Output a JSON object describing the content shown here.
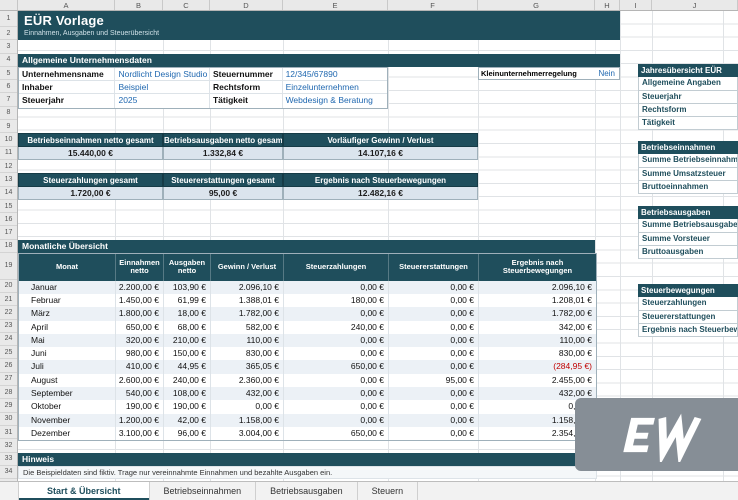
{
  "colors": {
    "accent": "#1F4E5C",
    "input_blue": "#2068B0",
    "negative": "#C00000",
    "summary_fill": "#DBE4ED"
  },
  "grid": {
    "cols": [
      "A",
      "B",
      "C",
      "D",
      "E",
      "F",
      "G",
      "H",
      "I",
      "J"
    ],
    "rows": [
      "1",
      "2",
      "3",
      "4",
      "5",
      "6",
      "7",
      "8",
      "9",
      "10",
      "11",
      "12",
      "13",
      "14",
      "15",
      "16",
      "17",
      "18",
      "19",
      "20",
      "21",
      "22",
      "23",
      "24",
      "25",
      "26",
      "27",
      "28",
      "29",
      "30",
      "31",
      "32",
      "33",
      "34"
    ]
  },
  "banner": {
    "title": "EÜR Vorlage",
    "subtitle": "Einnahmen, Ausgaben und Steuerübersicht"
  },
  "company": {
    "section_title": "Allgemeine Unternehmensdaten",
    "rows": [
      {
        "label1": "Unternehmensname",
        "value1": "Nordlicht Design Studio",
        "label2": "Steuernummer",
        "value2": "12/345/67890"
      },
      {
        "label1": "Inhaber",
        "value1": "Beispiel",
        "label2": "Rechtsform",
        "value2": "Einzelunternehmen"
      },
      {
        "label1": "Steuerjahr",
        "value1": "2025",
        "label2": "Tätigkeit",
        "value2": "Webdesign & Beratung"
      }
    ],
    "klein": {
      "label": "Kleinunternehmerregelung",
      "value": "Nein"
    }
  },
  "summary1": {
    "headers": [
      "Betriebseinnahmen netto gesamt",
      "Betriebsausgaben netto gesamt",
      "Vorläufiger Gewinn / Verlust"
    ],
    "values": [
      "15.440,00 €",
      "1.332,84 €",
      "14.107,16 €"
    ]
  },
  "summary2": {
    "headers": [
      "Steuerzahlungen gesamt",
      "Steuererstattungen gesamt",
      "Ergebnis nach Steuerbewegungen"
    ],
    "values": [
      "1.720,00 €",
      "95,00 €",
      "12.482,16 €"
    ]
  },
  "monthly": {
    "section_title": "Monatliche Übersicht",
    "headers": [
      "Monat",
      "Einnahmen netto",
      "Ausgaben netto",
      "Gewinn / Verlust",
      "Steuerzahlungen",
      "Steuererstattungen",
      "Ergebnis nach Steuerbewegungen"
    ],
    "rows": [
      {
        "monat": "Januar",
        "einnahmen": "2.200,00 €",
        "ausgaben": "103,90 €",
        "gewinn": "2.096,10 €",
        "zahlungen": "0,00 €",
        "erstattungen": "0,00 €",
        "ergebnis": "2.096,10 €"
      },
      {
        "monat": "Februar",
        "einnahmen": "1.450,00 €",
        "ausgaben": "61,99 €",
        "gewinn": "1.388,01 €",
        "zahlungen": "180,00 €",
        "erstattungen": "0,00 €",
        "ergebnis": "1.208,01 €"
      },
      {
        "monat": "März",
        "einnahmen": "1.800,00 €",
        "ausgaben": "18,00 €",
        "gewinn": "1.782,00 €",
        "zahlungen": "0,00 €",
        "erstattungen": "0,00 €",
        "ergebnis": "1.782,00 €"
      },
      {
        "monat": "April",
        "einnahmen": "650,00 €",
        "ausgaben": "68,00 €",
        "gewinn": "582,00 €",
        "zahlungen": "240,00 €",
        "erstattungen": "0,00 €",
        "ergebnis": "342,00 €"
      },
      {
        "monat": "Mai",
        "einnahmen": "320,00 €",
        "ausgaben": "210,00 €",
        "gewinn": "110,00 €",
        "zahlungen": "0,00 €",
        "erstattungen": "0,00 €",
        "ergebnis": "110,00 €"
      },
      {
        "monat": "Juni",
        "einnahmen": "980,00 €",
        "ausgaben": "150,00 €",
        "gewinn": "830,00 €",
        "zahlungen": "0,00 €",
        "erstattungen": "0,00 €",
        "ergebnis": "830,00 €"
      },
      {
        "monat": "Juli",
        "einnahmen": "410,00 €",
        "ausgaben": "44,95 €",
        "gewinn": "365,05 €",
        "zahlungen": "650,00 €",
        "erstattungen": "0,00 €",
        "ergebnis": "(284,95 €)"
      },
      {
        "monat": "August",
        "einnahmen": "2.600,00 €",
        "ausgaben": "240,00 €",
        "gewinn": "2.360,00 €",
        "zahlungen": "0,00 €",
        "erstattungen": "95,00 €",
        "ergebnis": "2.455,00 €"
      },
      {
        "monat": "September",
        "einnahmen": "540,00 €",
        "ausgaben": "108,00 €",
        "gewinn": "432,00 €",
        "zahlungen": "0,00 €",
        "erstattungen": "0,00 €",
        "ergebnis": "432,00 €"
      },
      {
        "monat": "Oktober",
        "einnahmen": "190,00 €",
        "ausgaben": "190,00 €",
        "gewinn": "0,00 €",
        "zahlungen": "0,00 €",
        "erstattungen": "0,00 €",
        "ergebnis": "0,00 €"
      },
      {
        "monat": "November",
        "einnahmen": "1.200,00 €",
        "ausgaben": "42,00 €",
        "gewinn": "1.158,00 €",
        "zahlungen": "0,00 €",
        "erstattungen": "0,00 €",
        "ergebnis": "1.158,00 €"
      },
      {
        "monat": "Dezember",
        "einnahmen": "3.100,00 €",
        "ausgaben": "96,00 €",
        "gewinn": "3.004,00 €",
        "zahlungen": "650,00 €",
        "erstattungen": "0,00 €",
        "ergebnis": "2.354,00 €"
      }
    ]
  },
  "hinweis": {
    "title": "Hinweis",
    "text": "Die Beispieldaten sind fiktiv. Trage nur vereinnahmte Einnahmen und bezahlte Ausgaben ein."
  },
  "sidebar": {
    "groups": [
      {
        "title": "Jahresübersicht EÜR",
        "items": [
          "Allgemeine Angaben",
          "Steuerjahr",
          "Rechtsform",
          "Tätigkeit"
        ]
      },
      {
        "title": "Betriebseinnahmen",
        "items": [
          "Summe Betriebseinnahmen",
          "Summe Umsatzsteuer",
          "Bruttoeinnahmen"
        ]
      },
      {
        "title": "Betriebsausgaben",
        "items": [
          "Summe Betriebsausgaben",
          "Summe Vorsteuer",
          "Bruttoausgaben"
        ]
      },
      {
        "title": "Steuerbewegungen",
        "items": [
          "Steuerzahlungen",
          "Steuererstattungen",
          "Ergebnis nach Steuerbewegungen"
        ]
      }
    ]
  },
  "tabs": [
    {
      "label": "Start & Übersicht"
    },
    {
      "label": "Betriebseinnahmen"
    },
    {
      "label": "Betriebsausgaben"
    },
    {
      "label": "Steuern"
    }
  ],
  "watermark": {
    "label": "EW"
  }
}
